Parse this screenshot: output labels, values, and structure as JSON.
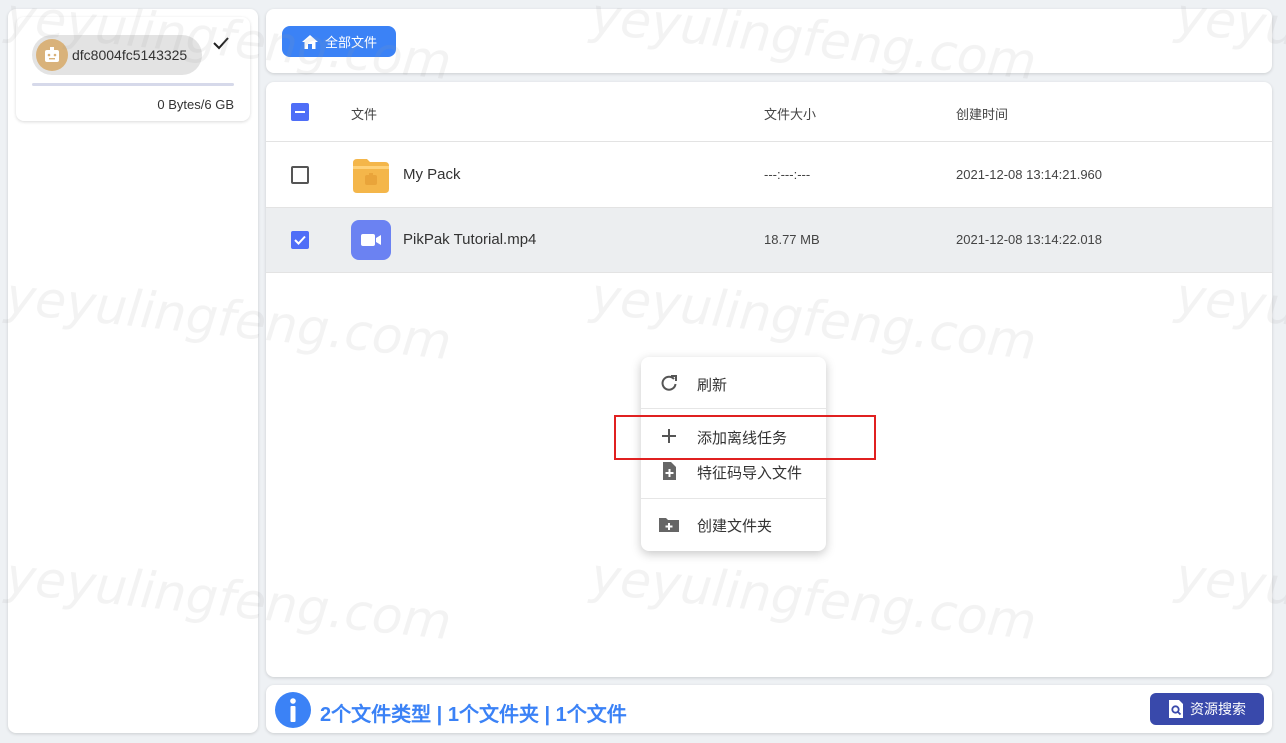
{
  "account": {
    "name": "dfc8004fc5143325",
    "quota_text": "0 Bytes/6 GB",
    "quota_fraction": 0
  },
  "topbar": {
    "all_files_label": "全部文件"
  },
  "table": {
    "columns": [
      "文件",
      "文件大小",
      "创建时间"
    ],
    "rows": [
      {
        "name": "My Pack",
        "size": "---:---:---",
        "created": "2021-12-08 13:14:21.960",
        "type": "folder",
        "checked": false
      },
      {
        "name": "PikPak Tutorial.mp4",
        "size": "18.77 MB",
        "created": "2021-12-08 13:14:22.018",
        "type": "video",
        "checked": true
      }
    ]
  },
  "context_menu": {
    "refresh": "刷新",
    "add_offline_task": "添加离线任务",
    "import_by_code": "特征码导入文件",
    "create_folder": "创建文件夹"
  },
  "bottombar": {
    "summary": "2个文件类型 | 1个文件夹 | 1个文件",
    "resource_search_label": "资源搜索"
  },
  "watermark": "yeyulingfeng.com",
  "colors": {
    "accent": "#3b82f6",
    "checkbox": "#4f6ef7",
    "folder": "#f4b64a",
    "video": "#6b82f2",
    "search_button": "#3949ab",
    "highlight": "#e02020"
  }
}
